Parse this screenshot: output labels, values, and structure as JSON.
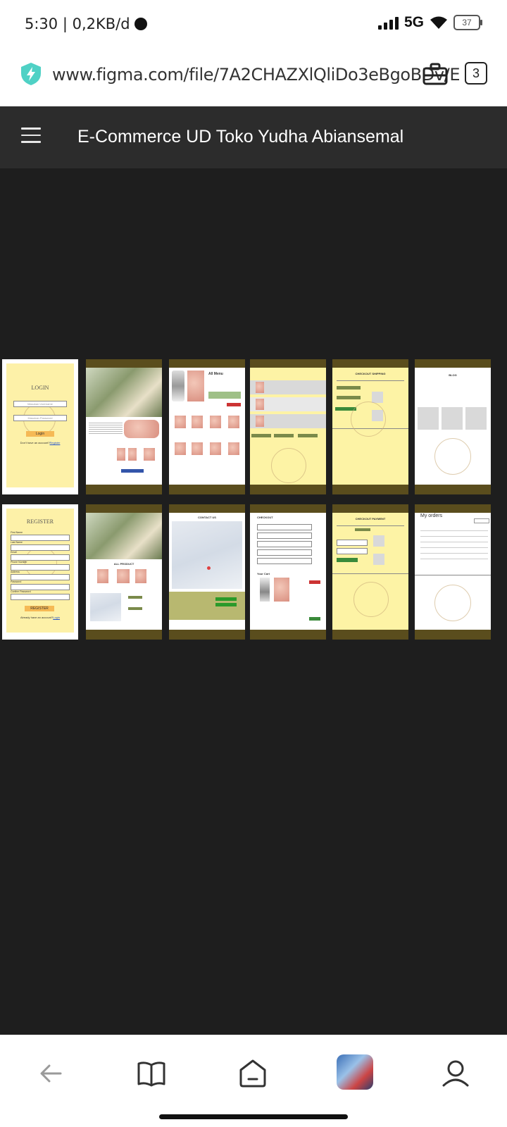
{
  "status_bar": {
    "time": "5:30",
    "speed": "0,2KB/d",
    "network": "5G",
    "battery": "37"
  },
  "browser": {
    "url": "www.figma.com/file/7A2CHAZXlQliDo3eBgoBDv/E",
    "tab_count": "3"
  },
  "app_bar": {
    "title": "E-Commerce UD Toko Yudha Abiansemal"
  },
  "frames": {
    "login": {
      "title": "LOGIN",
      "field1": "Masukan Username",
      "field2": "Masukan Password",
      "button": "Login",
      "footer_prefix": "Don't have an account?",
      "footer_link": "Register"
    },
    "register": {
      "title": "REGISTER",
      "labels": [
        "First Name",
        "Last Name",
        "Email",
        "Phone Number",
        "Address",
        "Password",
        "Confirm Password"
      ],
      "button": "REGISTER",
      "footer_prefix": "Already have an account?",
      "footer_link": "Login"
    },
    "all_menu": "All Menu",
    "all_product": "ALL PRODUCT",
    "contact_us": "CONTACT US",
    "checkout_shipping": "CHECKOUT SHIPPING",
    "checkout_payment": "CHECKOUT PAYMENT",
    "my_orders": "My orders",
    "blog": "BLOG",
    "cart": "Your Cart",
    "checkout": "CHECKOUT"
  },
  "nav_icons": [
    "back-icon",
    "book-icon",
    "home-icon",
    "game-app-icon",
    "profile-icon"
  ]
}
